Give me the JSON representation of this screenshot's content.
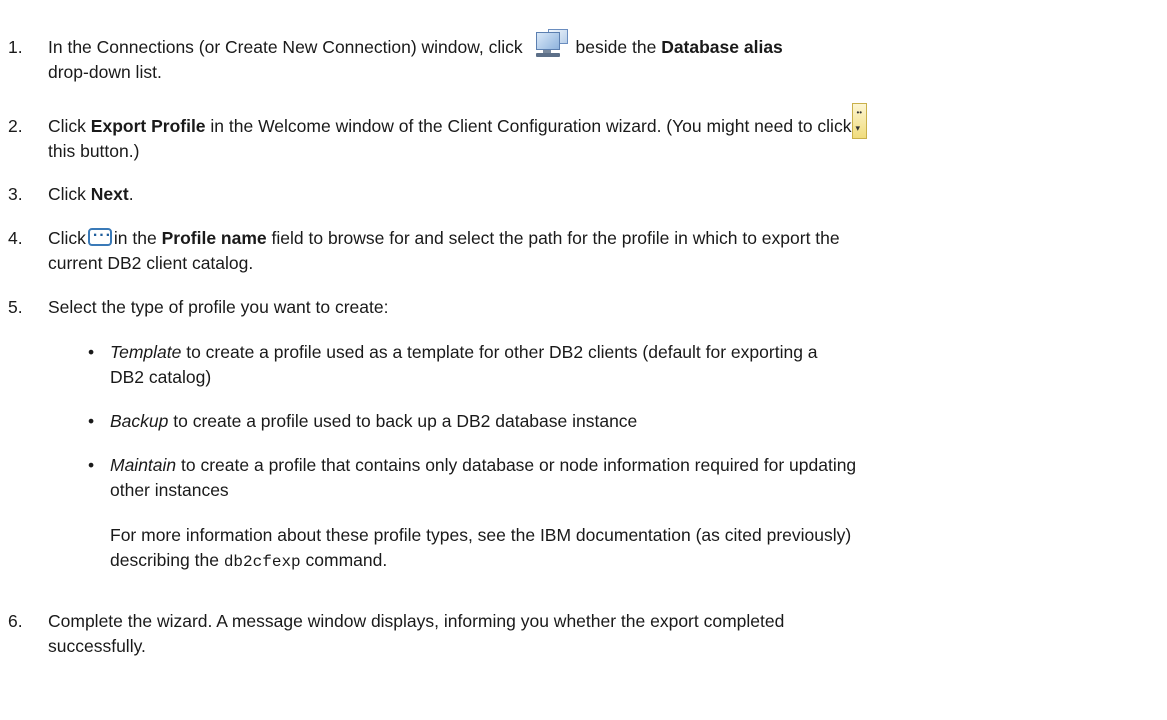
{
  "steps": [
    {
      "number": "1.",
      "a": "In the Connections (or Create New Connection) window, click",
      "b": "beside the",
      "bold": "Database alias",
      "c": "drop-down  list."
    },
    {
      "number": "2.",
      "a": "Click",
      "bold": "Export Profile",
      "b": "in the Welcome window of the Client Configuration wizard. (You might need to click",
      "c": "this button.)"
    },
    {
      "number": "3.",
      "a": "Click",
      "bold": "Next",
      "b": "."
    },
    {
      "number": "4.",
      "a": "Click",
      "b": "in the",
      "bold": "Profile name",
      "c": "field to browse for and select the path for the profile in which to export the",
      "d": "current DB2 client catalog."
    },
    {
      "number": "5.",
      "a": "Select the type of profile you want to create:"
    },
    {
      "number": "6.",
      "a": "Complete the wizard. A message window displays, informing you whether the export completed",
      "b": "successfully."
    }
  ],
  "bullets": [
    {
      "symbol": "•",
      "term": "Template",
      "line1": " to create a profile used as a template for other DB2 clients (default for exporting a",
      "line2": "DB2 catalog)"
    },
    {
      "symbol": "•",
      "term": "Backup",
      "line1": " to create a profile used to back up a DB2 database instance"
    },
    {
      "symbol": "•",
      "term": "Maintain",
      "line1": " to create a profile that contains only database or node information required for updating",
      "line2": "other instances"
    }
  ],
  "note": {
    "line1": "For more information about these profile types, see the IBM documentation (as cited previously)",
    "line2a": "describing the ",
    "code": "db2cfexp",
    "line2b": " command."
  },
  "icons": {
    "step1": "monitor-icon",
    "step2": "scroll-icon",
    "step4": "ellipsis-icon"
  }
}
